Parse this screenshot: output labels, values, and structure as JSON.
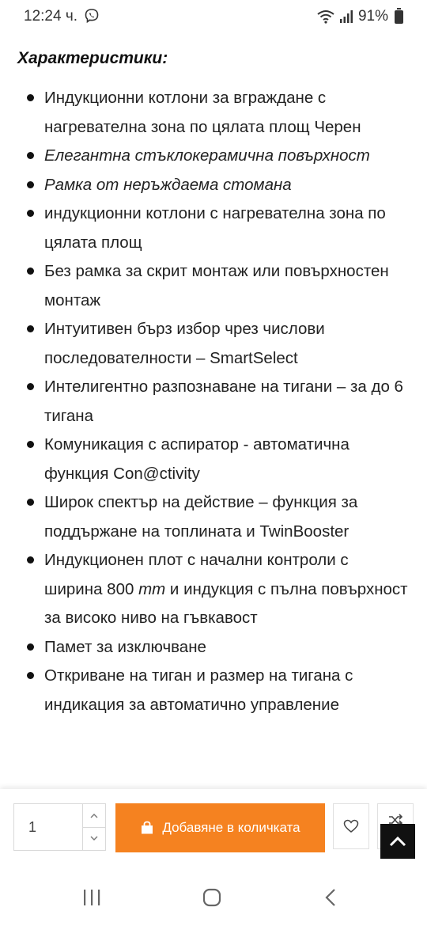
{
  "status_bar": {
    "time": "12:24 ч.",
    "battery": "91%"
  },
  "section": {
    "title": "Характеристики:"
  },
  "features": [
    {
      "text": "Индукционни котлони за вграждане с нагревателна зона по цялата площ Черен",
      "italic": false
    },
    {
      "text": "Елегантна стъклокерамична повърхност",
      "italic": true
    },
    {
      "text": "Рамка от неръждаема стомана",
      "italic": true
    },
    {
      "text": "индукционни котлони с нагревателна зона по цялата площ",
      "italic": false
    },
    {
      "text": "Без рамка за скрит монтаж или повърхностен монтаж",
      "italic": false
    },
    {
      "text": "Интуитивен бърз избор чрез числови последователности – SmartSelect",
      "italic": false
    },
    {
      "text": "Интелигентно разпознаване на тигани – за до 6 тигана",
      "italic": false
    },
    {
      "text": "Комуникация с аспиратор - автоматична функция Con@ctivity",
      "italic": false
    },
    {
      "text": "Широк спектър на действие – функция за поддържане на топлината и TwinBooster",
      "italic": false
    },
    {
      "text_before": "Индукционен плот с начални контроли с ширина 800 ",
      "unit": "mm",
      "text_after": "  и индукция с пълна повърхност за високо ниво на гъвкавост"
    },
    {
      "text": "Памет за изключване",
      "italic": false
    },
    {
      "text": "Откриване на тиган и размер на тигана с индикация за автоматично управление",
      "italic": false
    }
  ],
  "cart": {
    "quantity": "1",
    "add_label": "Добавяне в количката"
  },
  "colors": {
    "accent": "#f58220",
    "text": "#222222",
    "scroll_top_bg": "#111111"
  },
  "icons": {
    "viber": "viber-icon",
    "wifi": "wifi-icon",
    "signal": "signal-icon",
    "battery": "battery-icon",
    "bag": "shopping-bag-icon",
    "heart": "heart-icon",
    "compare": "compare-icon",
    "scroll_top": "chevron-up-icon"
  }
}
